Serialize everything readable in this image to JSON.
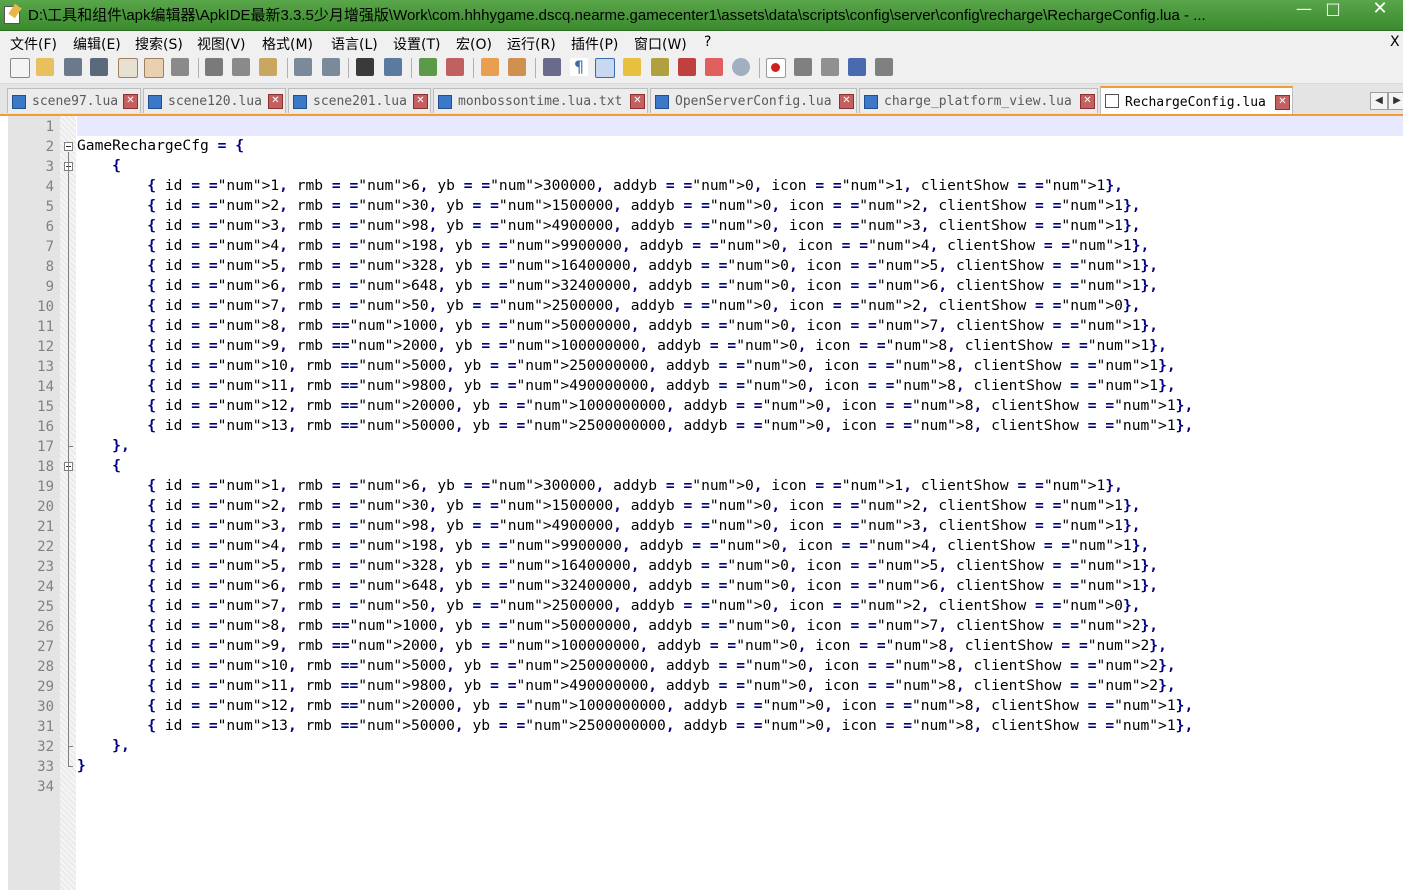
{
  "window": {
    "title": "D:\\工具和组件\\apk编辑器\\ApkIDE最新3.3.5少月增强版\\Work\\com.hhhygame.dscq.nearme.gamecenter1\\assets\\data\\scripts\\config\\server\\config\\recharge\\RechargeConfig.lua - ...",
    "minimize": "—",
    "maximize": "□",
    "close": "✕"
  },
  "menu": {
    "items": [
      "文件(F)",
      "编辑(E)",
      "搜索(S)",
      "视图(V)",
      "格式(M)",
      "语言(L)",
      "设置(T)",
      "宏(O)",
      "运行(R)",
      "插件(P)",
      "窗口(W)",
      "?"
    ],
    "close": "X"
  },
  "toolbar": {
    "icons": [
      "new-file-icon",
      "open-file-icon",
      "save-icon",
      "save-all-icon",
      "close-file-icon",
      "close-all-icon",
      "print-icon",
      "cut-icon",
      "copy-icon",
      "paste-icon",
      "undo-icon",
      "redo-icon",
      "find-icon",
      "replace-icon",
      "zoom-in-icon",
      "zoom-out-icon",
      "sync-vertical-icon",
      "sync-horizontal-icon",
      "wrap-icon",
      "show-all-chars-icon",
      "indent-guide-icon",
      "user-lang-icon",
      "doc-map-icon",
      "function-list-icon",
      "folder-workspace-icon",
      "monitor-icon",
      "record-macro-icon",
      "stop-macro-icon",
      "play-macro-icon",
      "run-macro-multiple-icon",
      "save-macro-icon"
    ]
  },
  "tabs": [
    {
      "label": "scene97.lua",
      "active": false
    },
    {
      "label": "scene120.lua",
      "active": false
    },
    {
      "label": "scene201.lua",
      "active": false
    },
    {
      "label": "monbossontime.lua.txt",
      "active": false
    },
    {
      "label": "OpenServerConfig.lua",
      "active": false
    },
    {
      "label": "charge_platform_view.lua",
      "active": false
    },
    {
      "label": "RechargeConfig.lua",
      "active": true
    }
  ],
  "tab_close": "✕",
  "tab_scroll": {
    "left": "◀",
    "right": "▶"
  },
  "editor": {
    "line_numbers": [
      "1",
      "2",
      "3",
      "4",
      "5",
      "6",
      "7",
      "8",
      "9",
      "10",
      "11",
      "12",
      "13",
      "14",
      "15",
      "16",
      "17",
      "18",
      "19",
      "20",
      "21",
      "22",
      "23",
      "24",
      "25",
      "26",
      "27",
      "28",
      "29",
      "30",
      "31",
      "32",
      "33",
      "34"
    ],
    "lines": [
      "",
      "GameRechargeCfg = {",
      "    {",
      "        { id = 1, rmb = 6, yb = 300000, addyb = 0, icon = 1, clientShow = 1},",
      "        { id = 2, rmb = 30, yb = 1500000, addyb = 0, icon = 2, clientShow = 1},",
      "        { id = 3, rmb = 98, yb = 4900000, addyb = 0, icon = 3, clientShow = 1},",
      "        { id = 4, rmb = 198, yb = 9900000, addyb = 0, icon = 4, clientShow = 1},",
      "        { id = 5, rmb = 328, yb = 16400000, addyb = 0, icon = 5, clientShow = 1},",
      "        { id = 6, rmb = 648, yb = 32400000, addyb = 0, icon = 6, clientShow = 1},",
      "        { id = 7, rmb = 50, yb = 2500000, addyb = 0, icon = 2, clientShow = 0},",
      "        { id = 8, rmb =1000, yb = 50000000, addyb = 0, icon = 7, clientShow = 1},",
      "        { id = 9, rmb =2000, yb = 100000000, addyb = 0, icon = 8, clientShow = 1},",
      "        { id = 10, rmb =5000, yb = 250000000, addyb = 0, icon = 8, clientShow = 1},",
      "        { id = 11, rmb =9800, yb = 490000000, addyb = 0, icon = 8, clientShow = 1},",
      "        { id = 12, rmb =20000, yb = 1000000000, addyb = 0, icon = 8, clientShow = 1},",
      "        { id = 13, rmb =50000, yb = 2500000000, addyb = 0, icon = 8, clientShow = 1},",
      "    },",
      "    {",
      "        { id = 1, rmb = 6, yb = 300000, addyb = 0, icon = 1, clientShow = 1},",
      "        { id = 2, rmb = 30, yb = 1500000, addyb = 0, icon = 2, clientShow = 1},",
      "        { id = 3, rmb = 98, yb = 4900000, addyb = 0, icon = 3, clientShow = 1},",
      "        { id = 4, rmb = 198, yb = 9900000, addyb = 0, icon = 4, clientShow = 1},",
      "        { id = 5, rmb = 328, yb = 16400000, addyb = 0, icon = 5, clientShow = 1},",
      "        { id = 6, rmb = 648, yb = 32400000, addyb = 0, icon = 6, clientShow = 1},",
      "        { id = 7, rmb = 50, yb = 2500000, addyb = 0, icon = 2, clientShow = 0},",
      "        { id = 8, rmb =1000, yb = 50000000, addyb = 0, icon = 7, clientShow = 2},",
      "        { id = 9, rmb =2000, yb = 100000000, addyb = 0, icon = 8, clientShow = 2},",
      "        { id = 10, rmb =5000, yb = 250000000, addyb = 0, icon = 8, clientShow = 2},",
      "        { id = 11, rmb =9800, yb = 490000000, addyb = 0, icon = 8, clientShow = 2},",
      "        { id = 12, rmb =20000, yb = 1000000000, addyb = 0, icon = 8, clientShow = 1},",
      "        { id = 13, rmb =50000, yb = 2500000000, addyb = 0, icon = 8, clientShow = 1},",
      "    },",
      "}",
      ""
    ]
  },
  "colors": {
    "number": "#ff8000",
    "operator": "#000080",
    "active_tab_accent": "#f39c34",
    "titlebar": "#4a9a3c"
  }
}
